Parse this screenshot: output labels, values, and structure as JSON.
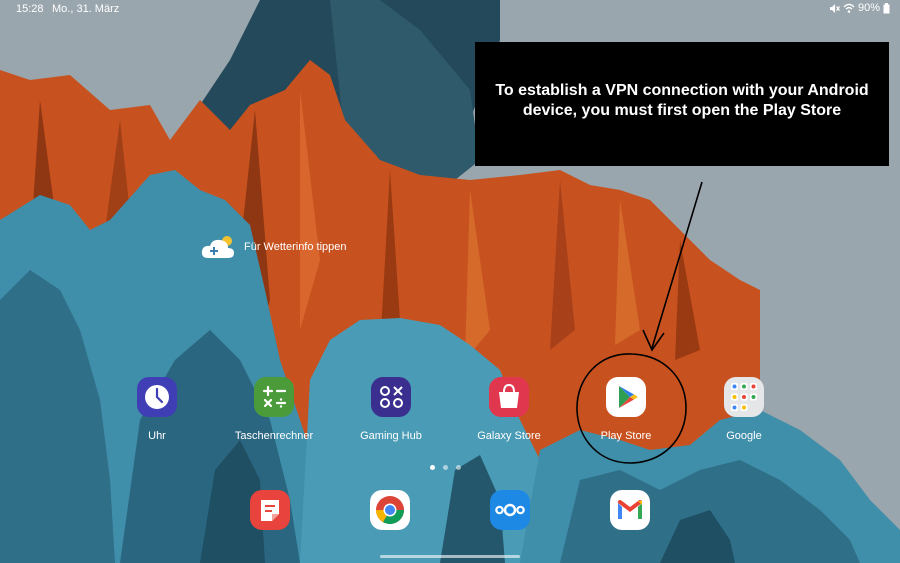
{
  "status_bar": {
    "time": "15:28",
    "date": "Mo., 31. März",
    "battery": "90%",
    "icons": [
      "mute-icon",
      "wifi-icon",
      "battery-icon"
    ]
  },
  "callout": {
    "line1": "To establish a VPN connection with your Android",
    "line2": "device, you must first open the Play Store"
  },
  "weather_widget": {
    "label": "Für Wetterinfo tippen",
    "icon": "weather-cloud-add-icon"
  },
  "apps": [
    {
      "label": "Uhr",
      "icon": "clock-icon"
    },
    {
      "label": "Taschenrechner",
      "icon": "calculator-icon"
    },
    {
      "label": "Gaming Hub",
      "icon": "gaming-hub-icon"
    },
    {
      "label": "Galaxy Store",
      "icon": "shopping-bag-icon"
    },
    {
      "label": "Play Store",
      "icon": "play-store-icon"
    },
    {
      "label": "Google",
      "icon": "google-folder-icon"
    }
  ],
  "dock": [
    {
      "icon": "notes-icon"
    },
    {
      "icon": "chrome-icon"
    },
    {
      "icon": "nextcloud-icon"
    },
    {
      "icon": "gmail-icon"
    }
  ],
  "page_indicator": {
    "pages": 3,
    "current": 1
  },
  "colors": {
    "sky": "#9aa6ad",
    "orange_rock": "#c8521f",
    "blue_rock": "#3f8eaa",
    "callout_bg": "#000000"
  }
}
